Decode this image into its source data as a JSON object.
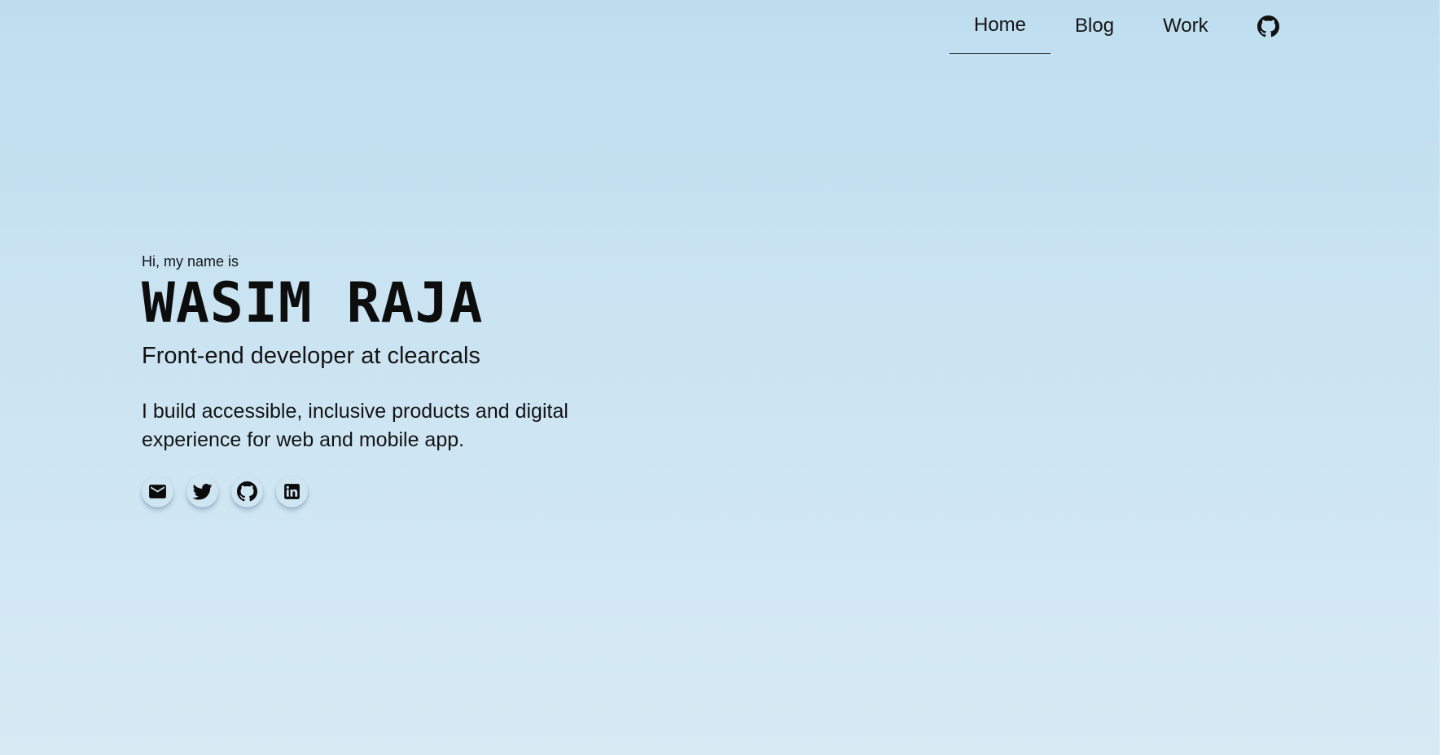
{
  "nav": {
    "items": [
      {
        "label": "Home",
        "active": true
      },
      {
        "label": "Blog",
        "active": false
      },
      {
        "label": "Work",
        "active": false
      }
    ],
    "github_icon": "github-icon"
  },
  "hero": {
    "greeting": "Hi, my name is",
    "name": "WASIM RAJA",
    "role": "Front-end developer at clearcals",
    "bio": "I build accessible, inclusive products and digital experience for web and mobile app."
  },
  "socials": [
    {
      "icon": "mail-icon"
    },
    {
      "icon": "twitter-icon"
    },
    {
      "icon": "github-icon"
    },
    {
      "icon": "linkedin-icon"
    }
  ],
  "colors": {
    "background_top": "#bedeef",
    "background_bottom": "#d7ebf5",
    "text": "#141414"
  }
}
